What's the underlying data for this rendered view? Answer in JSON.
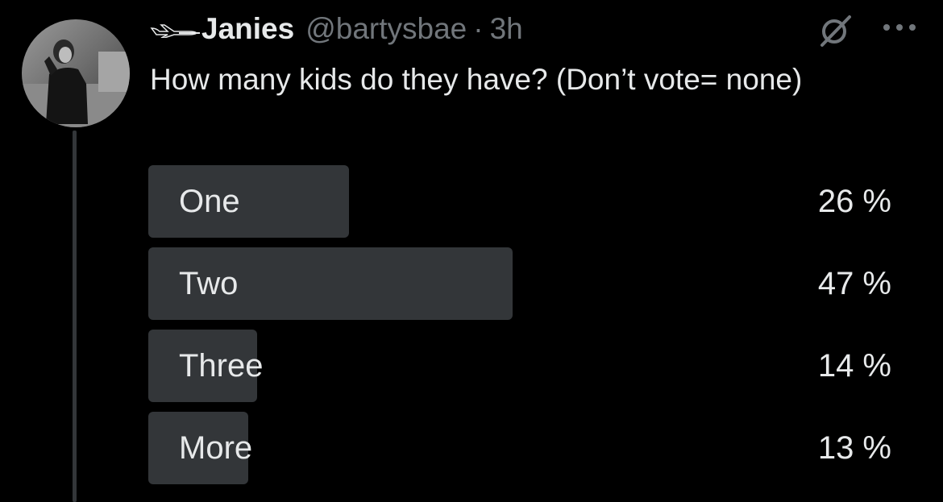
{
  "tweet": {
    "display_name": "Janies",
    "handle": "@bartysbae",
    "separator": "·",
    "time": "3h",
    "text": "How many kids do they have? (Don’t vote= none)"
  },
  "icons": {
    "name_prefix": "airplane-icon",
    "grok": "grok-icon",
    "more": "more-icon"
  },
  "poll": {
    "options": [
      {
        "label": "One",
        "percent_label": "26 %",
        "fill": 0.27
      },
      {
        "label": "Two",
        "percent_label": "47 %",
        "fill": 0.49
      },
      {
        "label": "Three",
        "percent_label": "14 %",
        "fill": 0.146
      },
      {
        "label": "More",
        "percent_label": "13 %",
        "fill": 0.135
      }
    ]
  },
  "colors": {
    "background": "#000000",
    "primary_text": "#e7e9ea",
    "secondary_text": "#71767b",
    "poll_bar": "#333639",
    "thread_line": "#333639"
  }
}
